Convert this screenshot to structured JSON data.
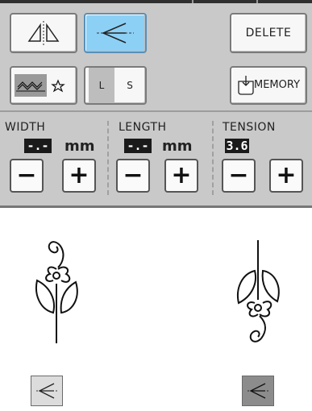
{
  "buttons": {
    "delete_label": "DELETE",
    "memory_label": "MEMORY",
    "l_label": "L",
    "s_label": "S"
  },
  "settings": {
    "width": {
      "label": "WIDTH",
      "value": "-.-",
      "unit": "mm"
    },
    "length": {
      "label": "LENGTH",
      "value": "-.-",
      "unit": "mm"
    },
    "tension": {
      "label": "TENSION",
      "value": "3.6"
    }
  },
  "stepper": {
    "minus": "−",
    "plus": "+"
  },
  "colors": {
    "panel": "#c9c9c9",
    "selected_button": "#8dd0f5",
    "value_box": "#1a1a1a",
    "preview_button_right": "#8c8c8c",
    "preview_button_left": "#dcdcdc"
  },
  "icons": {
    "mirror": "mirror-horizontal-icon",
    "direction": "stitch-direction-icon",
    "single_triple": "single-triple-stitch-icon",
    "memory": "memory-pocket-icon"
  }
}
